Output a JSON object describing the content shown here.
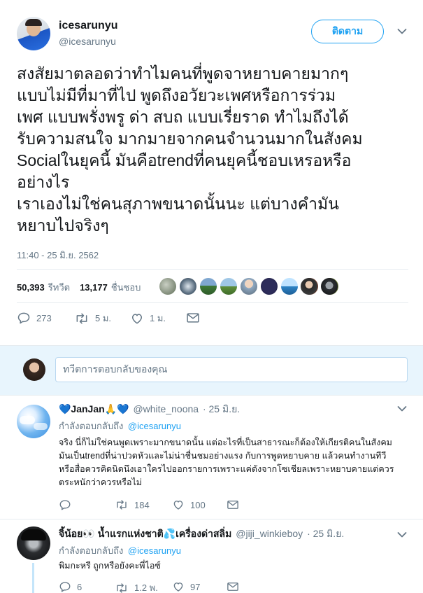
{
  "author": {
    "display_name": "icesarunyu",
    "handle": "@icesarunyu",
    "follow_label": "ติดตาม"
  },
  "tweet": {
    "lines": [
      "สงสัยมาตลอดว่าทำไมคนที่พูดจาหยาบคายมากๆ",
      "แบบไม่มีที่มาที่ไป พูดถึงอวัยวะเพศหรือการร่วม",
      "เพศ แบบพรั่งพรู ด่า สบถ แบบเรี่ยราด ทำไมถึงได้",
      "รับความสนใจ มากมายจากคนจำนวนมากในสังคม",
      "Socialในยุคนี้ มันคือtrendที่คนยุคนี้ชอบเหรอหรือ",
      "อย่างไร",
      "เราเองไม่ใช่คนสุภาพขนาดนั้นนะ แต่บางคำมัน",
      "หยาบไปจริงๆ"
    ],
    "timestamp": "11:40 - 25 มิ.ย. 2562",
    "retweets_count": "50,393",
    "retweets_label": "รีทวีต",
    "likes_count": "13,177",
    "likes_label": "ชื่นชอบ",
    "actions": {
      "reply": "273",
      "retweet": "5 ม.",
      "like": "1 ม."
    }
  },
  "reply_box": {
    "placeholder": "ทวีตการตอบกลับของคุณ"
  },
  "replies": [
    {
      "display_name": "💙JanJan🙏💙",
      "handle": "@white_noona",
      "date": "· 25 มิ.ย.",
      "replying_prefix": "กำลังตอบกลับถึง",
      "replying_to": "@icesarunyu",
      "text_lines": [
        "จริง นี่ก็ไม่ใช่คนพูดเพราะมากขนาดนั้น แต่อะไรที่เป็นสาธารณะก็ต้องให้เกียรติคนในสังคม",
        "มันเป็นtrendที่น่าปวดหัวและไม่น่าชื่นชมอย่างแรง กับการพูดหยาบคาย แล้วคนทำงานทีวี",
        "หรือสื่อควรคิดนิดนึงเอาใครไปออกรายการเพราะแค่ดังจากโซเชียลเพราะหยาบคายแต่ควร",
        "ตระหนักว่าควรหรือไม่"
      ],
      "actions": {
        "reply": "",
        "retweet": "184",
        "like": "100"
      }
    },
    {
      "display_name": "จิ้น้อย👀 น้ำแรกแห่งชาติ💦เครื่องด่าสลิ่ม",
      "handle": "@jiji_winkieboy",
      "date": "· 25 มิ.ย.",
      "replying_prefix": "กำลังตอบกลับถึง",
      "replying_to": "@icesarunyu",
      "text_lines": [
        "พิมกะหรี ถูกหรือยังคะพี่ไอซ์"
      ],
      "actions": {
        "reply": "6",
        "retweet": "1.2 พ.",
        "like": "97"
      }
    }
  ],
  "colors": {
    "accent": "#1da1f2",
    "muted": "#657786",
    "divider": "#e6ecf0"
  }
}
